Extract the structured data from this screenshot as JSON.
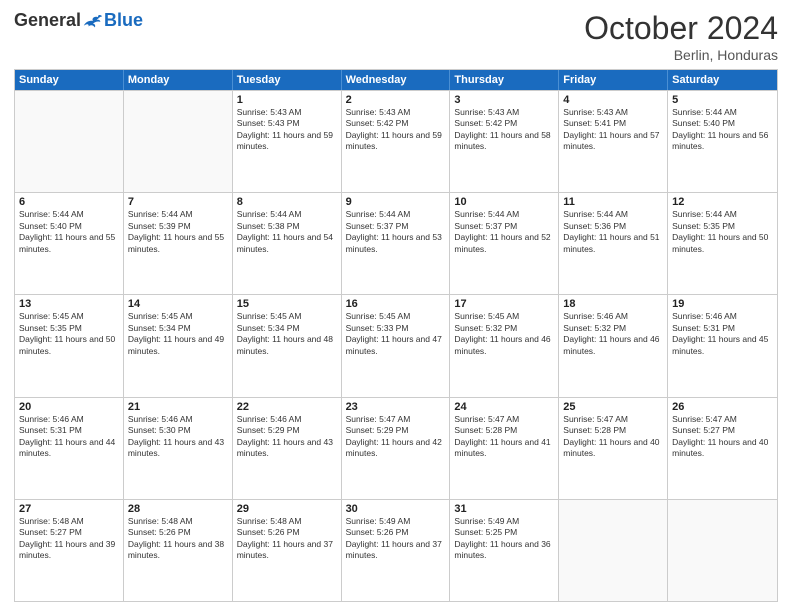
{
  "header": {
    "logo_general": "General",
    "logo_blue": "Blue",
    "month_title": "October 2024",
    "subtitle": "Berlin, Honduras"
  },
  "days_of_week": [
    "Sunday",
    "Monday",
    "Tuesday",
    "Wednesday",
    "Thursday",
    "Friday",
    "Saturday"
  ],
  "weeks": [
    [
      {
        "day": "",
        "info": ""
      },
      {
        "day": "",
        "info": ""
      },
      {
        "day": "1",
        "info": "Sunrise: 5:43 AM\nSunset: 5:43 PM\nDaylight: 11 hours and 59 minutes."
      },
      {
        "day": "2",
        "info": "Sunrise: 5:43 AM\nSunset: 5:42 PM\nDaylight: 11 hours and 59 minutes."
      },
      {
        "day": "3",
        "info": "Sunrise: 5:43 AM\nSunset: 5:42 PM\nDaylight: 11 hours and 58 minutes."
      },
      {
        "day": "4",
        "info": "Sunrise: 5:43 AM\nSunset: 5:41 PM\nDaylight: 11 hours and 57 minutes."
      },
      {
        "day": "5",
        "info": "Sunrise: 5:44 AM\nSunset: 5:40 PM\nDaylight: 11 hours and 56 minutes."
      }
    ],
    [
      {
        "day": "6",
        "info": "Sunrise: 5:44 AM\nSunset: 5:40 PM\nDaylight: 11 hours and 55 minutes."
      },
      {
        "day": "7",
        "info": "Sunrise: 5:44 AM\nSunset: 5:39 PM\nDaylight: 11 hours and 55 minutes."
      },
      {
        "day": "8",
        "info": "Sunrise: 5:44 AM\nSunset: 5:38 PM\nDaylight: 11 hours and 54 minutes."
      },
      {
        "day": "9",
        "info": "Sunrise: 5:44 AM\nSunset: 5:37 PM\nDaylight: 11 hours and 53 minutes."
      },
      {
        "day": "10",
        "info": "Sunrise: 5:44 AM\nSunset: 5:37 PM\nDaylight: 11 hours and 52 minutes."
      },
      {
        "day": "11",
        "info": "Sunrise: 5:44 AM\nSunset: 5:36 PM\nDaylight: 11 hours and 51 minutes."
      },
      {
        "day": "12",
        "info": "Sunrise: 5:44 AM\nSunset: 5:35 PM\nDaylight: 11 hours and 50 minutes."
      }
    ],
    [
      {
        "day": "13",
        "info": "Sunrise: 5:45 AM\nSunset: 5:35 PM\nDaylight: 11 hours and 50 minutes."
      },
      {
        "day": "14",
        "info": "Sunrise: 5:45 AM\nSunset: 5:34 PM\nDaylight: 11 hours and 49 minutes."
      },
      {
        "day": "15",
        "info": "Sunrise: 5:45 AM\nSunset: 5:34 PM\nDaylight: 11 hours and 48 minutes."
      },
      {
        "day": "16",
        "info": "Sunrise: 5:45 AM\nSunset: 5:33 PM\nDaylight: 11 hours and 47 minutes."
      },
      {
        "day": "17",
        "info": "Sunrise: 5:45 AM\nSunset: 5:32 PM\nDaylight: 11 hours and 46 minutes."
      },
      {
        "day": "18",
        "info": "Sunrise: 5:46 AM\nSunset: 5:32 PM\nDaylight: 11 hours and 46 minutes."
      },
      {
        "day": "19",
        "info": "Sunrise: 5:46 AM\nSunset: 5:31 PM\nDaylight: 11 hours and 45 minutes."
      }
    ],
    [
      {
        "day": "20",
        "info": "Sunrise: 5:46 AM\nSunset: 5:31 PM\nDaylight: 11 hours and 44 minutes."
      },
      {
        "day": "21",
        "info": "Sunrise: 5:46 AM\nSunset: 5:30 PM\nDaylight: 11 hours and 43 minutes."
      },
      {
        "day": "22",
        "info": "Sunrise: 5:46 AM\nSunset: 5:29 PM\nDaylight: 11 hours and 43 minutes."
      },
      {
        "day": "23",
        "info": "Sunrise: 5:47 AM\nSunset: 5:29 PM\nDaylight: 11 hours and 42 minutes."
      },
      {
        "day": "24",
        "info": "Sunrise: 5:47 AM\nSunset: 5:28 PM\nDaylight: 11 hours and 41 minutes."
      },
      {
        "day": "25",
        "info": "Sunrise: 5:47 AM\nSunset: 5:28 PM\nDaylight: 11 hours and 40 minutes."
      },
      {
        "day": "26",
        "info": "Sunrise: 5:47 AM\nSunset: 5:27 PM\nDaylight: 11 hours and 40 minutes."
      }
    ],
    [
      {
        "day": "27",
        "info": "Sunrise: 5:48 AM\nSunset: 5:27 PM\nDaylight: 11 hours and 39 minutes."
      },
      {
        "day": "28",
        "info": "Sunrise: 5:48 AM\nSunset: 5:26 PM\nDaylight: 11 hours and 38 minutes."
      },
      {
        "day": "29",
        "info": "Sunrise: 5:48 AM\nSunset: 5:26 PM\nDaylight: 11 hours and 37 minutes."
      },
      {
        "day": "30",
        "info": "Sunrise: 5:49 AM\nSunset: 5:26 PM\nDaylight: 11 hours and 37 minutes."
      },
      {
        "day": "31",
        "info": "Sunrise: 5:49 AM\nSunset: 5:25 PM\nDaylight: 11 hours and 36 minutes."
      },
      {
        "day": "",
        "info": ""
      },
      {
        "day": "",
        "info": ""
      }
    ]
  ]
}
